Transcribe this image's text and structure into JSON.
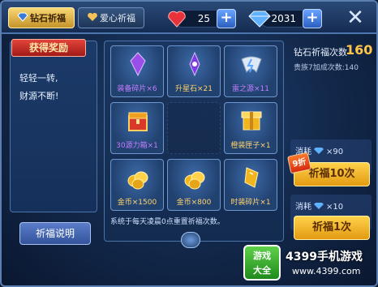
{
  "tabs": [
    {
      "label": "钻石祈福",
      "active": true
    },
    {
      "label": "爱心祈福",
      "active": false
    }
  ],
  "resources": {
    "hearts": "25",
    "diamonds": "2031"
  },
  "left": {
    "reward_title": "获得奖励",
    "slogan_line1": "轻轻一转,",
    "slogan_line2": "财源不断!",
    "rules_button": "祈福说明"
  },
  "grid_items": [
    {
      "label": "装备碎片×6",
      "icon": "purple-crystal-icon",
      "color": "#c37dff"
    },
    {
      "label": "升星石×21",
      "icon": "purple-star-crystal-icon",
      "color": "#ffd36b"
    },
    {
      "label": "雷之源×11",
      "icon": "thunder-source-icon",
      "color": "#c37dff"
    },
    {
      "label": "30源力箱×1",
      "icon": "red-chest-icon",
      "color": "#c37dff"
    },
    {
      "label": "橙装匣子×1",
      "icon": "gold-box-icon",
      "color": "#ffd36b"
    },
    {
      "label": "金币×1500",
      "icon": "gold-coins-icon",
      "color": "#ffd36b"
    },
    {
      "label": "金币×800",
      "icon": "gold-coins-icon",
      "color": "#ffd36b"
    },
    {
      "label": "时装碎片×1",
      "icon": "gold-fragment-icon",
      "color": "#ffd36b"
    }
  ],
  "reset_note": "系统于每天凌晨0点重置祈福次数。",
  "right": {
    "count_label": "钻石祈福次数",
    "count_value": "160",
    "vip_note": "贵族7加成次数:140",
    "cost_label": "消耗",
    "cost_ten": "×90",
    "cost_one": "×10",
    "discount_badge": "9折",
    "pray_ten": "祈福10次",
    "pray_one": "祈福1次"
  },
  "watermark": {
    "logo_line1": "游戏",
    "logo_line2": "大全",
    "title": "4399手机游戏",
    "url": "www.4399.com"
  },
  "colors": {
    "gold": "#ffc64a",
    "purple": "#c37dff",
    "panel": "#1a355f"
  }
}
